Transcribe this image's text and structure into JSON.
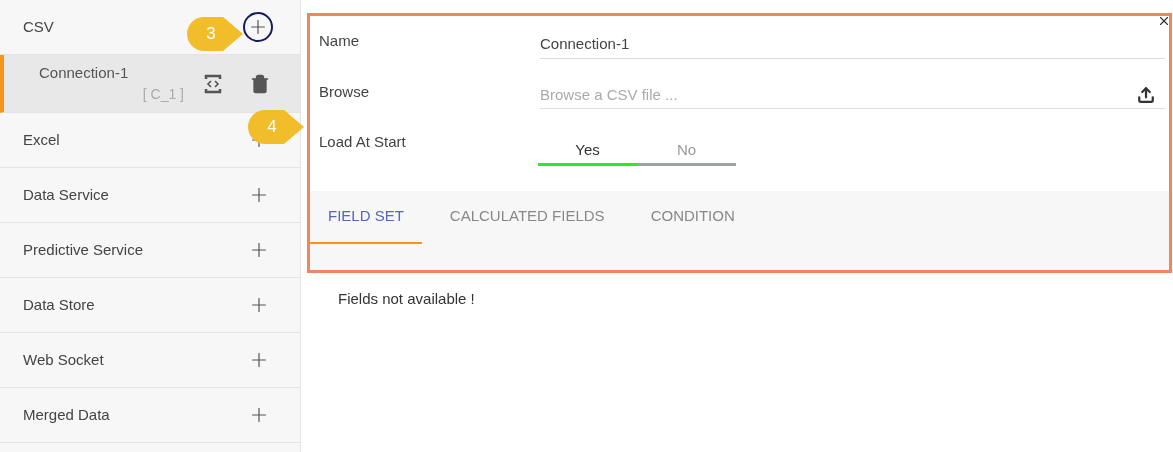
{
  "sidebar": {
    "categories": [
      {
        "label": "CSV",
        "connections": [
          {
            "name": "Connection-1",
            "code": "[ C_1 ]",
            "selected": true
          }
        ]
      },
      {
        "label": "Excel"
      },
      {
        "label": "Data Service"
      },
      {
        "label": "Predictive Service"
      },
      {
        "label": "Data Store"
      },
      {
        "label": "Web Socket"
      },
      {
        "label": "Merged Data"
      }
    ]
  },
  "form": {
    "name": {
      "label": "Name",
      "value": "Connection-1"
    },
    "browse": {
      "label": "Browse",
      "placeholder": "Browse a CSV file ..."
    },
    "load_at_start": {
      "label": "Load At Start",
      "options": [
        {
          "label": "Yes",
          "selected": true
        },
        {
          "label": "No",
          "selected": false
        }
      ]
    }
  },
  "tabs": [
    {
      "label": "FIELD SET",
      "selected": true
    },
    {
      "label": "CALCULATED FIELDS",
      "selected": false
    },
    {
      "label": "CONDITION",
      "selected": false
    }
  ],
  "empty_message": "Fields not available !",
  "callouts": [
    {
      "label": "3"
    },
    {
      "label": "4"
    }
  ]
}
